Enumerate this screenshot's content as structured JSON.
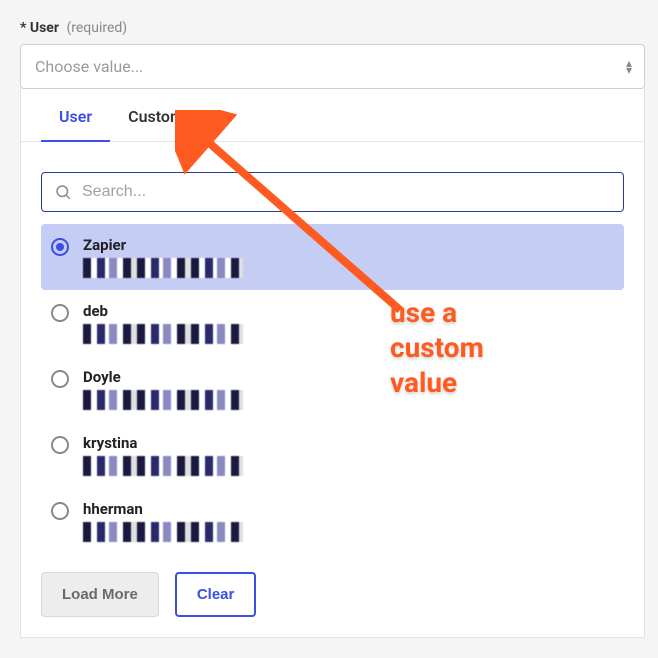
{
  "field": {
    "asterisk": "*",
    "label": "User",
    "hint": "(required)",
    "placeholder": "Choose value..."
  },
  "tabs": {
    "user": "User",
    "custom": "Custom"
  },
  "search": {
    "placeholder": "Search..."
  },
  "options": [
    {
      "name": "Zapier",
      "selected": true
    },
    {
      "name": "deb",
      "selected": false
    },
    {
      "name": "Doyle",
      "selected": false
    },
    {
      "name": "krystina",
      "selected": false
    },
    {
      "name": "hherman",
      "selected": false
    }
  ],
  "buttons": {
    "loadMore": "Load More",
    "clear": "Clear"
  },
  "annotation": {
    "text": "use a\ncustom\nvalue"
  },
  "colors": {
    "accent": "#3b4ee6",
    "annotation": "#ff5a1f"
  }
}
